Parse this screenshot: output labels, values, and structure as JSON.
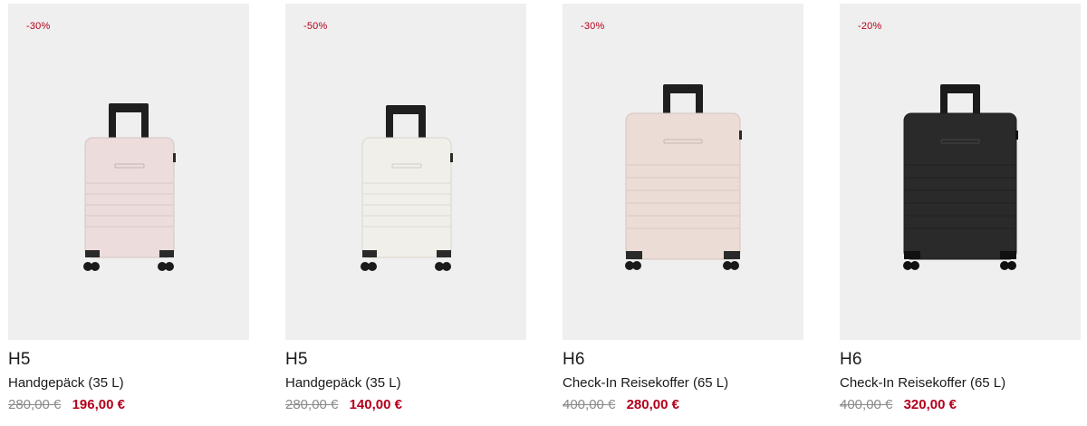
{
  "products": [
    {
      "badge": "-30%",
      "model": "H5",
      "name": "Handgepäck (35 L)",
      "old_price": "280,00 €",
      "new_price": "196,00 €",
      "suitcase_color": "#ecdcdc",
      "image": "pink-carry-on-suitcase"
    },
    {
      "badge": "-50%",
      "model": "H5",
      "name": "Handgepäck (35 L)",
      "old_price": "280,00 €",
      "new_price": "140,00 €",
      "suitcase_color": "#f1efe9",
      "image": "white-carry-on-suitcase"
    },
    {
      "badge": "-30%",
      "model": "H6",
      "name": "Check-In Reisekoffer (65 L)",
      "old_price": "400,00 €",
      "new_price": "280,00 €",
      "suitcase_color": "#ecdcd6",
      "image": "pink-check-in-suitcase"
    },
    {
      "badge": "-20%",
      "model": "H6",
      "name": "Check-In Reisekoffer (65 L)",
      "old_price": "400,00 €",
      "new_price": "320,00 €",
      "suitcase_color": "#2a2a2a",
      "image": "black-check-in-suitcase"
    }
  ],
  "colors": {
    "sale_red": "#b3001b",
    "image_background": "#efefef",
    "strikethrough_grey": "#8a8a8a"
  }
}
